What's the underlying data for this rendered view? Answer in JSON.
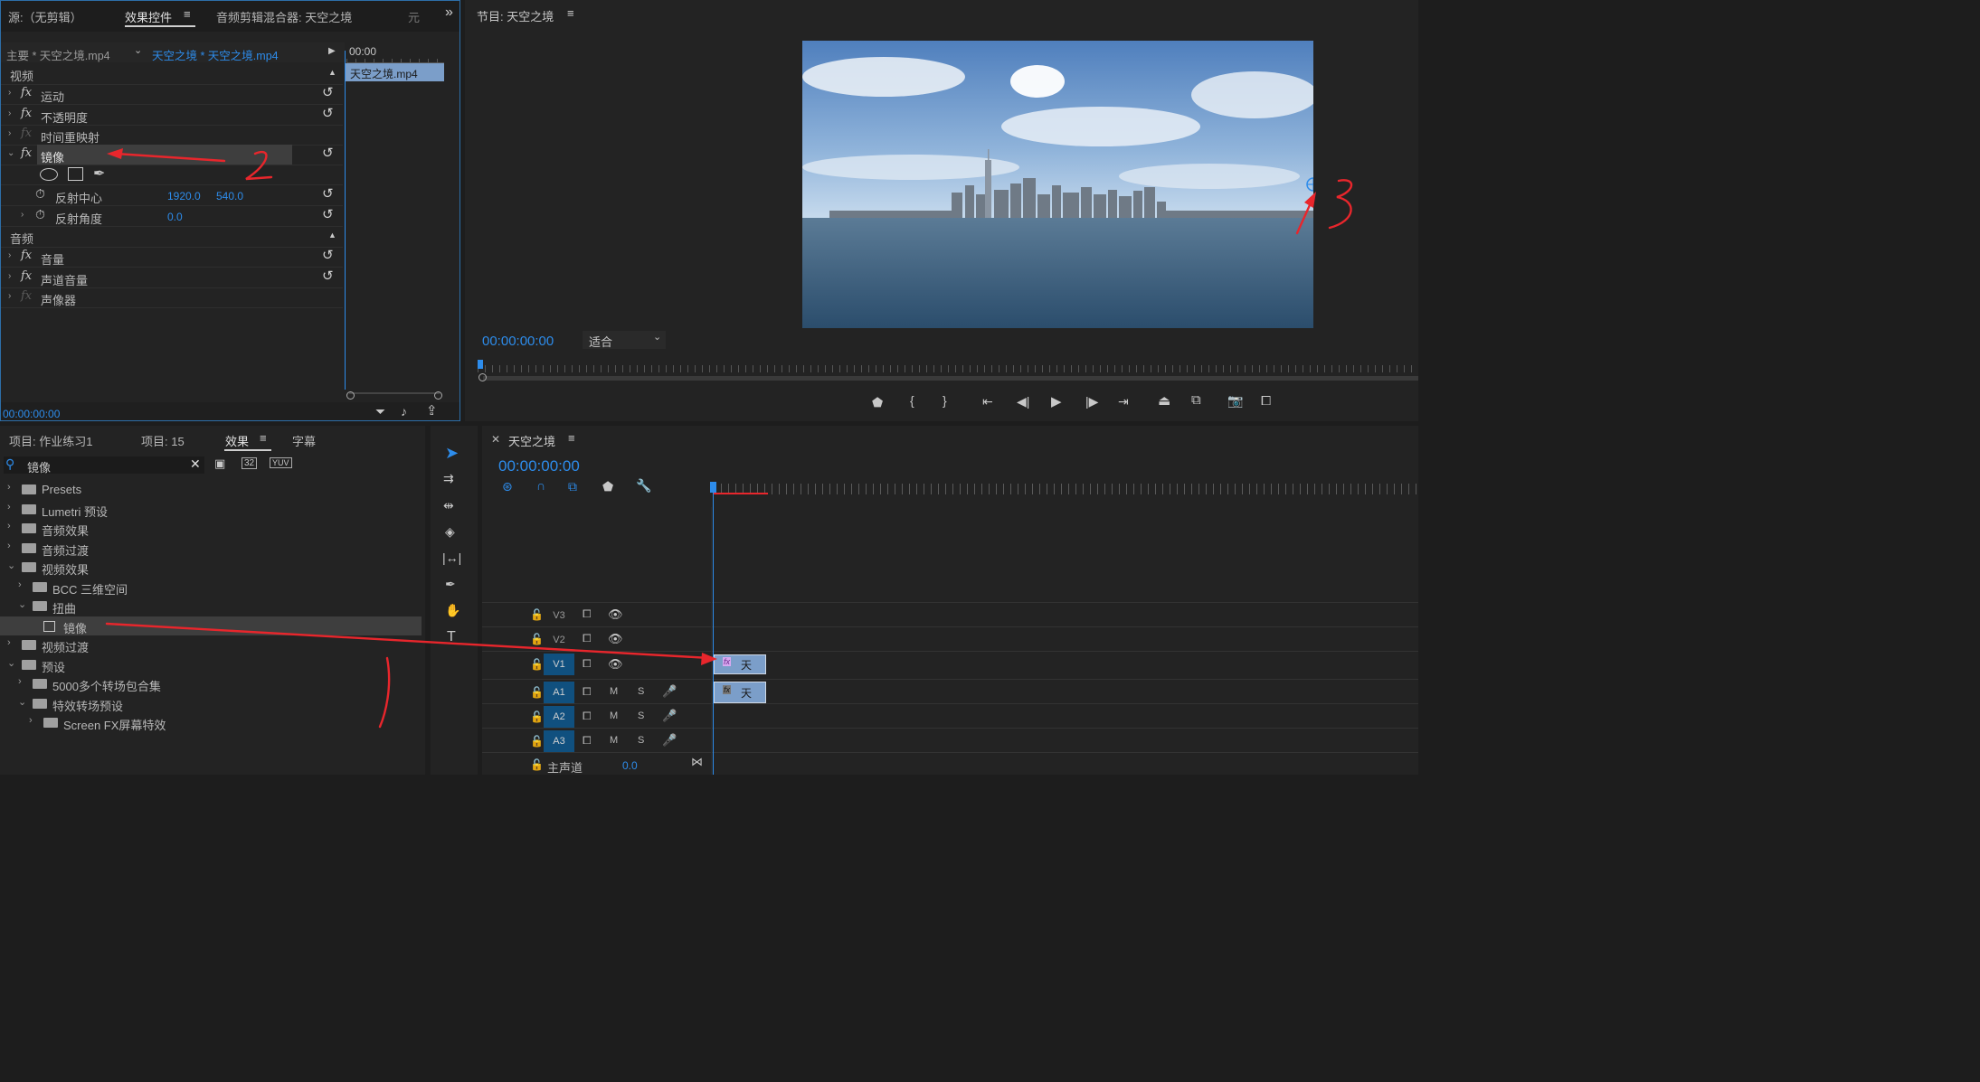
{
  "source_panel": {
    "tabs": [
      "源:（无剪辑）",
      "效果控件",
      "音频剪辑混合器: 天空之境",
      "元"
    ],
    "overflow": "»",
    "master_clip": "主要 * 天空之境.mp4",
    "sequence_clip": "天空之境 * 天空之境.mp4",
    "ruler_time": "00:00",
    "clip_label": "天空之境.mp4",
    "section_video": "视频",
    "effects": [
      "运动",
      "不透明度",
      "时间重映射",
      "镜像"
    ],
    "params": [
      {
        "name": "反射中心",
        "v1": "1920.0",
        "v2": "540.0"
      },
      {
        "name": "反射角度",
        "v1": "0.0",
        "v2": ""
      }
    ],
    "section_audio": "音频",
    "audio_effects": [
      "音量",
      "声道音量",
      "声像器"
    ],
    "timecode": "00:00:00:00"
  },
  "program": {
    "title": "节目: 天空之境",
    "timecode": "00:00:00:00",
    "fit": "适合"
  },
  "project_panel": {
    "tabs": [
      "项目: 作业练习1",
      "项目: 15",
      "效果",
      "字幕"
    ],
    "search_value": "镜像",
    "tree": [
      {
        "label": "Presets",
        "indent": 0,
        "open": false
      },
      {
        "label": "Lumetri 预设",
        "indent": 0,
        "open": false
      },
      {
        "label": "音频效果",
        "indent": 0,
        "open": false
      },
      {
        "label": "音频过渡",
        "indent": 0,
        "open": false
      },
      {
        "label": "视频效果",
        "indent": 0,
        "open": true
      },
      {
        "label": "BCC 三维空间",
        "indent": 1,
        "open": false
      },
      {
        "label": "扭曲",
        "indent": 1,
        "open": true
      },
      {
        "label": "镜像",
        "indent": 2,
        "open": false
      },
      {
        "label": "视频过渡",
        "indent": 0,
        "open": false
      },
      {
        "label": "预设",
        "indent": 0,
        "open": true
      },
      {
        "label": "5000多个转场包合集",
        "indent": 1,
        "open": false
      },
      {
        "label": "特效转场预设",
        "indent": 1,
        "open": true
      },
      {
        "label": "Screen FX屏幕特效",
        "indent": 2,
        "open": false
      }
    ]
  },
  "timeline": {
    "title": "天空之境",
    "timecode": "00:00:00:00",
    "tracks_video": [
      "V3",
      "V2",
      "V1"
    ],
    "tracks_audio": [
      "A1",
      "A2",
      "A3"
    ],
    "master": "主声道",
    "master_value": "0.0",
    "mute": "M",
    "solo": "S",
    "clip_v": "天",
    "clip_a": "天"
  },
  "annotations": {
    "mark2": "2",
    "mark3": "3"
  },
  "colors": {
    "accent": "#2d8ceb",
    "arrow": "#e8262c",
    "track": "#10507f",
    "clip": "#7b9ec9"
  }
}
